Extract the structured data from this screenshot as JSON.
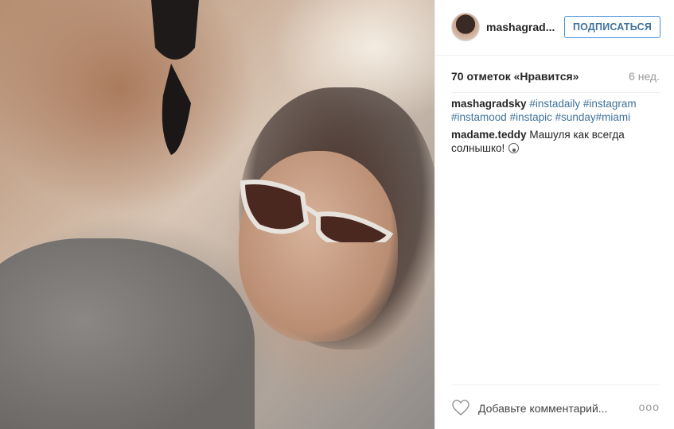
{
  "post": {
    "image_alt": "Selfie photo",
    "username": "mashagrad...",
    "follow_label": "ПОДПИСАТЬСЯ",
    "likes": "70 отметок «Нравится»",
    "age": "6 нед."
  },
  "caption": {
    "user": "mashagradsky",
    "tags": [
      "#instadaily",
      "#instagram",
      "#instamood",
      "#instapic",
      "#sunday",
      "#miami"
    ]
  },
  "comment": {
    "user": "madame.teddy",
    "text": "Машуля как всегда солнышко!"
  },
  "footer": {
    "comment_placeholder": "Добавьте комментарий...",
    "more": "ooo"
  },
  "icons": {
    "like": "heart-icon",
    "more": "more-options-icon",
    "emoji": "surprised-emoji-icon"
  }
}
